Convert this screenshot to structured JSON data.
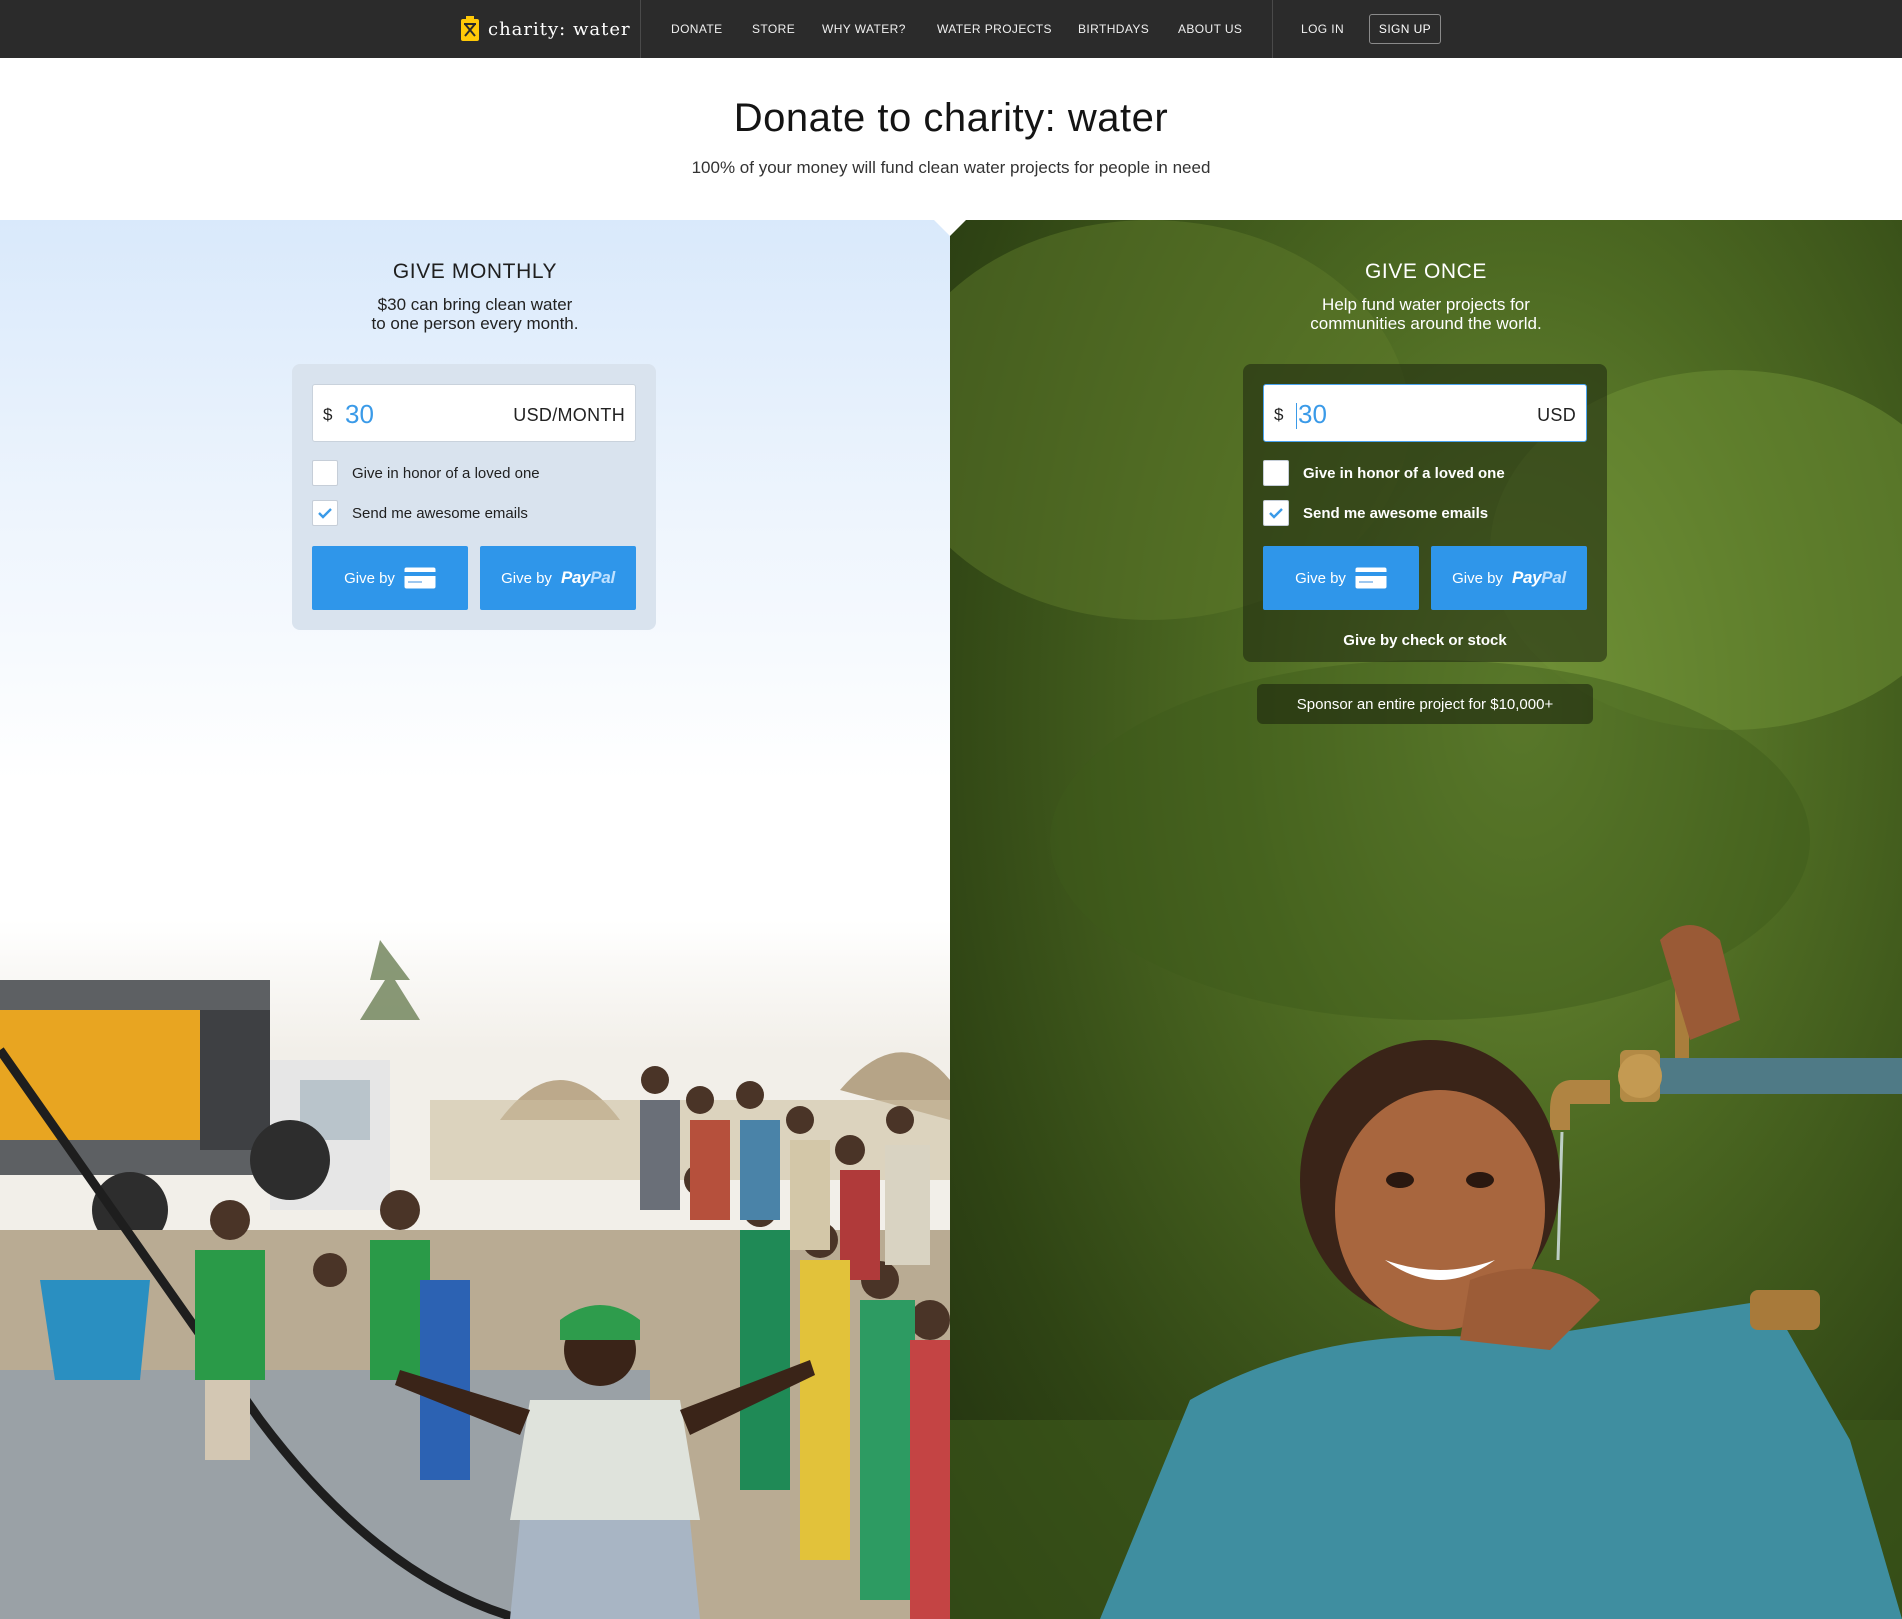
{
  "nav": {
    "brand": "charity: water",
    "links": [
      "DONATE",
      "STORE",
      "WHY WATER?",
      "WATER PROJECTS",
      "BIRTHDAYS",
      "ABOUT US"
    ],
    "login": "LOG IN",
    "signup": "SIGN UP"
  },
  "hero": {
    "title": "Donate to charity: water",
    "subtitle": "100% of your money will fund clean water projects for people in need"
  },
  "monthly": {
    "heading": "GIVE MONTHLY",
    "desc_line1": "$30 can bring clean water",
    "desc_line2": "to one person every month.",
    "currency": "$",
    "amount": "30",
    "unit": "USD/MONTH",
    "honor_label": "Give in honor of a loved one",
    "honor_checked": false,
    "emails_label": "Send me awesome emails",
    "emails_checked": true,
    "card_btn": "Give by",
    "paypal_btn": "Give by",
    "paypal_pay": "Pay",
    "paypal_pal": "Pal"
  },
  "once": {
    "heading": "GIVE ONCE",
    "desc_line1": "Help fund water projects for",
    "desc_line2": "communities around the world.",
    "currency": "$",
    "amount": "30",
    "unit": "USD",
    "honor_label": "Give in honor of a loved one",
    "honor_checked": false,
    "emails_label": "Send me awesome emails",
    "emails_checked": true,
    "card_btn": "Give by",
    "paypal_btn": "Give by",
    "paypal_pay": "Pay",
    "paypal_pal": "Pal",
    "check_stock": "Give by check or stock",
    "sponsor": "Sponsor an entire project for $10,000+"
  },
  "colors": {
    "nav_bg": "#2b2b2b",
    "accent_blue": "#2f96ea",
    "logo_yellow": "#ffc907"
  },
  "icons": [
    "jerrycan-logo-icon",
    "credit-card-icon",
    "checkmark-icon"
  ]
}
